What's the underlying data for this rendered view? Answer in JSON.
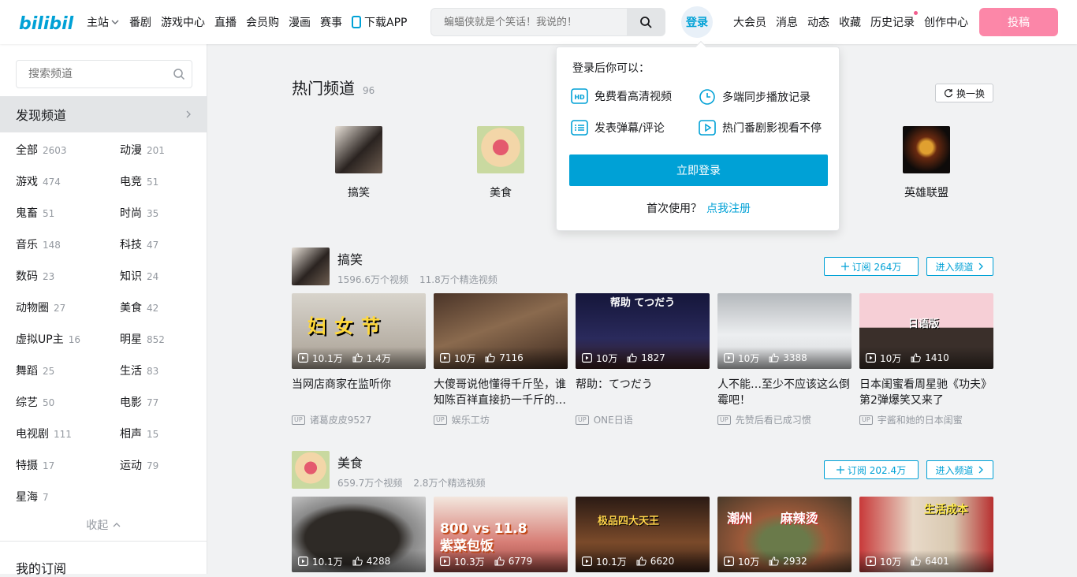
{
  "header": {
    "logo_text": "bilibili",
    "nav_left": [
      "主站",
      "番剧",
      "游戏中心",
      "直播",
      "会员购",
      "漫画",
      "赛事",
      "下载APP"
    ],
    "search_placeholder": "蝙蝠侠就是个笑话！我说的！",
    "login_label": "登录",
    "nav_right": [
      "大会员",
      "消息",
      "动态",
      "收藏",
      "历史记录",
      "创作中心"
    ],
    "upload_label": "投稿",
    "colors": {
      "brand": "#00a1d6",
      "pink": "#fb7299"
    }
  },
  "sidebar": {
    "search_placeholder": "搜索频道",
    "discover_label": "发现频道",
    "categories": [
      {
        "name": "全部",
        "count": "2603"
      },
      {
        "name": "动漫",
        "count": "201"
      },
      {
        "name": "游戏",
        "count": "474"
      },
      {
        "name": "电竞",
        "count": "51"
      },
      {
        "name": "鬼畜",
        "count": "51"
      },
      {
        "name": "时尚",
        "count": "35"
      },
      {
        "name": "音乐",
        "count": "148"
      },
      {
        "name": "科技",
        "count": "47"
      },
      {
        "name": "数码",
        "count": "23"
      },
      {
        "name": "知识",
        "count": "24"
      },
      {
        "name": "动物圈",
        "count": "27"
      },
      {
        "name": "美食",
        "count": "42"
      },
      {
        "name": "虚拟UP主",
        "count": "16"
      },
      {
        "name": "明星",
        "count": "852"
      },
      {
        "name": "舞蹈",
        "count": "25"
      },
      {
        "name": "生活",
        "count": "83"
      },
      {
        "name": "综艺",
        "count": "50"
      },
      {
        "name": "电影",
        "count": "77"
      },
      {
        "name": "电视剧",
        "count": "111"
      },
      {
        "name": "相声",
        "count": "15"
      },
      {
        "name": "特摄",
        "count": "17"
      },
      {
        "name": "运动",
        "count": "79"
      },
      {
        "name": "星海",
        "count": "7"
      }
    ],
    "collapse_label": "收起",
    "my_subs_label": "我的订阅"
  },
  "hot": {
    "title": "热门频道",
    "count": "96",
    "swap_label": "换一换",
    "items": [
      "搞笑",
      "美食",
      "英雄联盟"
    ]
  },
  "sections": [
    {
      "name": "搞笑",
      "videos_stat": "1596.6万个视频",
      "featured_stat": "11.8万个精选视频",
      "subscribe_label": "订阅 264万",
      "enter_label": "进入频道",
      "cards": [
        {
          "plays": "10.1万",
          "likes": "1.4万",
          "title": "当网店商家在监听你",
          "up": "诸葛皮皮9527",
          "cover_text": "妇女节"
        },
        {
          "plays": "10万",
          "likes": "7116",
          "title": "大傻哥说他懂得千斤坠，谁知陈百祥直接扔一千斤的…",
          "up": "娱乐工坊",
          "cover_text": ""
        },
        {
          "plays": "10万",
          "likes": "1827",
          "title": "帮助：てつだう",
          "up": "ONE日语",
          "cover_text": "帮助 てつだう"
        },
        {
          "plays": "10万",
          "likes": "3388",
          "title": "人不能…至少不应该这么倒霉吧！",
          "up": "先赞后看已成习惯",
          "cover_text": ""
        },
        {
          "plays": "10万",
          "likes": "1410",
          "title": "日本闺蜜看周星驰《功夫》第2弹爆笑又来了",
          "up": "宇酱和她的日本闺蜜",
          "cover_text": "日语版"
        }
      ]
    },
    {
      "name": "美食",
      "videos_stat": "659.7万个视频",
      "featured_stat": "2.8万个精选视频",
      "subscribe_label": "订阅 202.4万",
      "enter_label": "进入频道",
      "cards": [
        {
          "plays": "10.1万",
          "likes": "4288",
          "cover_text": ""
        },
        {
          "plays": "10.3万",
          "likes": "6779",
          "cover_text": "800 vs 11.8 紫菜包饭"
        },
        {
          "plays": "10.1万",
          "likes": "6620",
          "cover_text": "极品四大天王"
        },
        {
          "plays": "10万",
          "likes": "2932",
          "cover_text": "潮州 麻辣烫"
        },
        {
          "plays": "10万",
          "likes": "6401",
          "cover_text": "生活成本"
        }
      ]
    }
  ],
  "login_popup": {
    "title": "登录后你可以：",
    "benefits": [
      "免费看高清视频",
      "多端同步播放记录",
      "发表弹幕/评论",
      "热门番剧影视看不停"
    ],
    "button": "立即登录",
    "register_prompt": "首次使用？",
    "register_link": "点我注册"
  }
}
